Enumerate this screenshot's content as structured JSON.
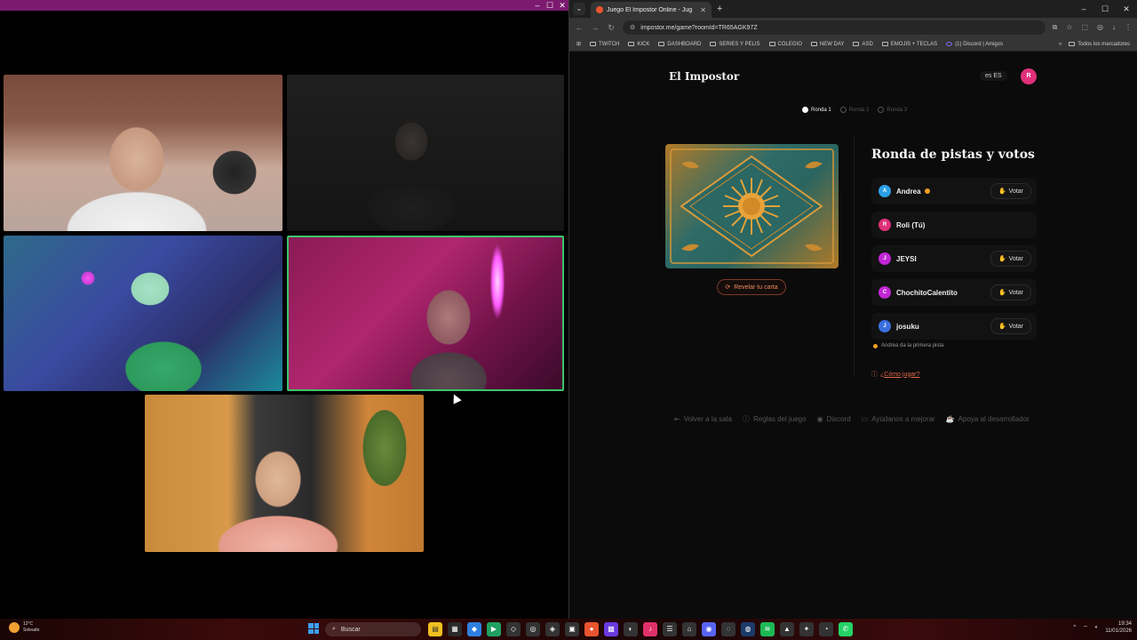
{
  "browser": {
    "tab_title": "Juego El Impostor Online - Jug",
    "url": "impostor.me/game?roomId=TR65AGK97Z",
    "bookmarks": [
      "TWITCH",
      "KICK",
      "DASHBOARD",
      "SERIES Y PELIS",
      "COLEGIO",
      "NEW DAY",
      "ASD",
      "EMOJIS + TECLAS",
      "(1) Discord | Amigos"
    ],
    "all_bookmarks": "Todos los marcadores"
  },
  "site": {
    "title": "El Impostor",
    "lang": "es ES",
    "user_initial": "R",
    "rounds": [
      "Ronda 1",
      "Ronda 2",
      "Ronda 3"
    ],
    "reveal_button": "Revelar tu carta",
    "panel_title": "Ronda de pistas y votos",
    "vote_label": "Votar",
    "players": [
      {
        "initial": "A",
        "name": "Andrea",
        "color": "#2aa0e6",
        "turn": true,
        "can_vote": true
      },
      {
        "initial": "R",
        "name": "Roli (Tú)",
        "color": "#e0307a",
        "turn": false,
        "can_vote": false
      },
      {
        "initial": "J",
        "name": "JEYSI",
        "color": "#c026d3",
        "turn": false,
        "can_vote": true
      },
      {
        "initial": "C",
        "name": "ChochitoCalentito",
        "color": "#c026d3",
        "turn": false,
        "can_vote": true
      },
      {
        "initial": "J",
        "name": "josuku",
        "color": "#3b6fe0",
        "turn": false,
        "can_vote": true
      }
    ],
    "hint": "Andrea da la primera pista",
    "how_to": "¿Cómo jugar?",
    "footer": [
      "Volver a la sala",
      "Reglas del juego",
      "Discord",
      "Ayúdanos a mejorar",
      "Apoya al desarrollador"
    ]
  },
  "taskbar": {
    "temp": "12°C",
    "weather": "Soleado",
    "search": "Buscar",
    "time": "19:34",
    "date": "11/01/2026"
  }
}
